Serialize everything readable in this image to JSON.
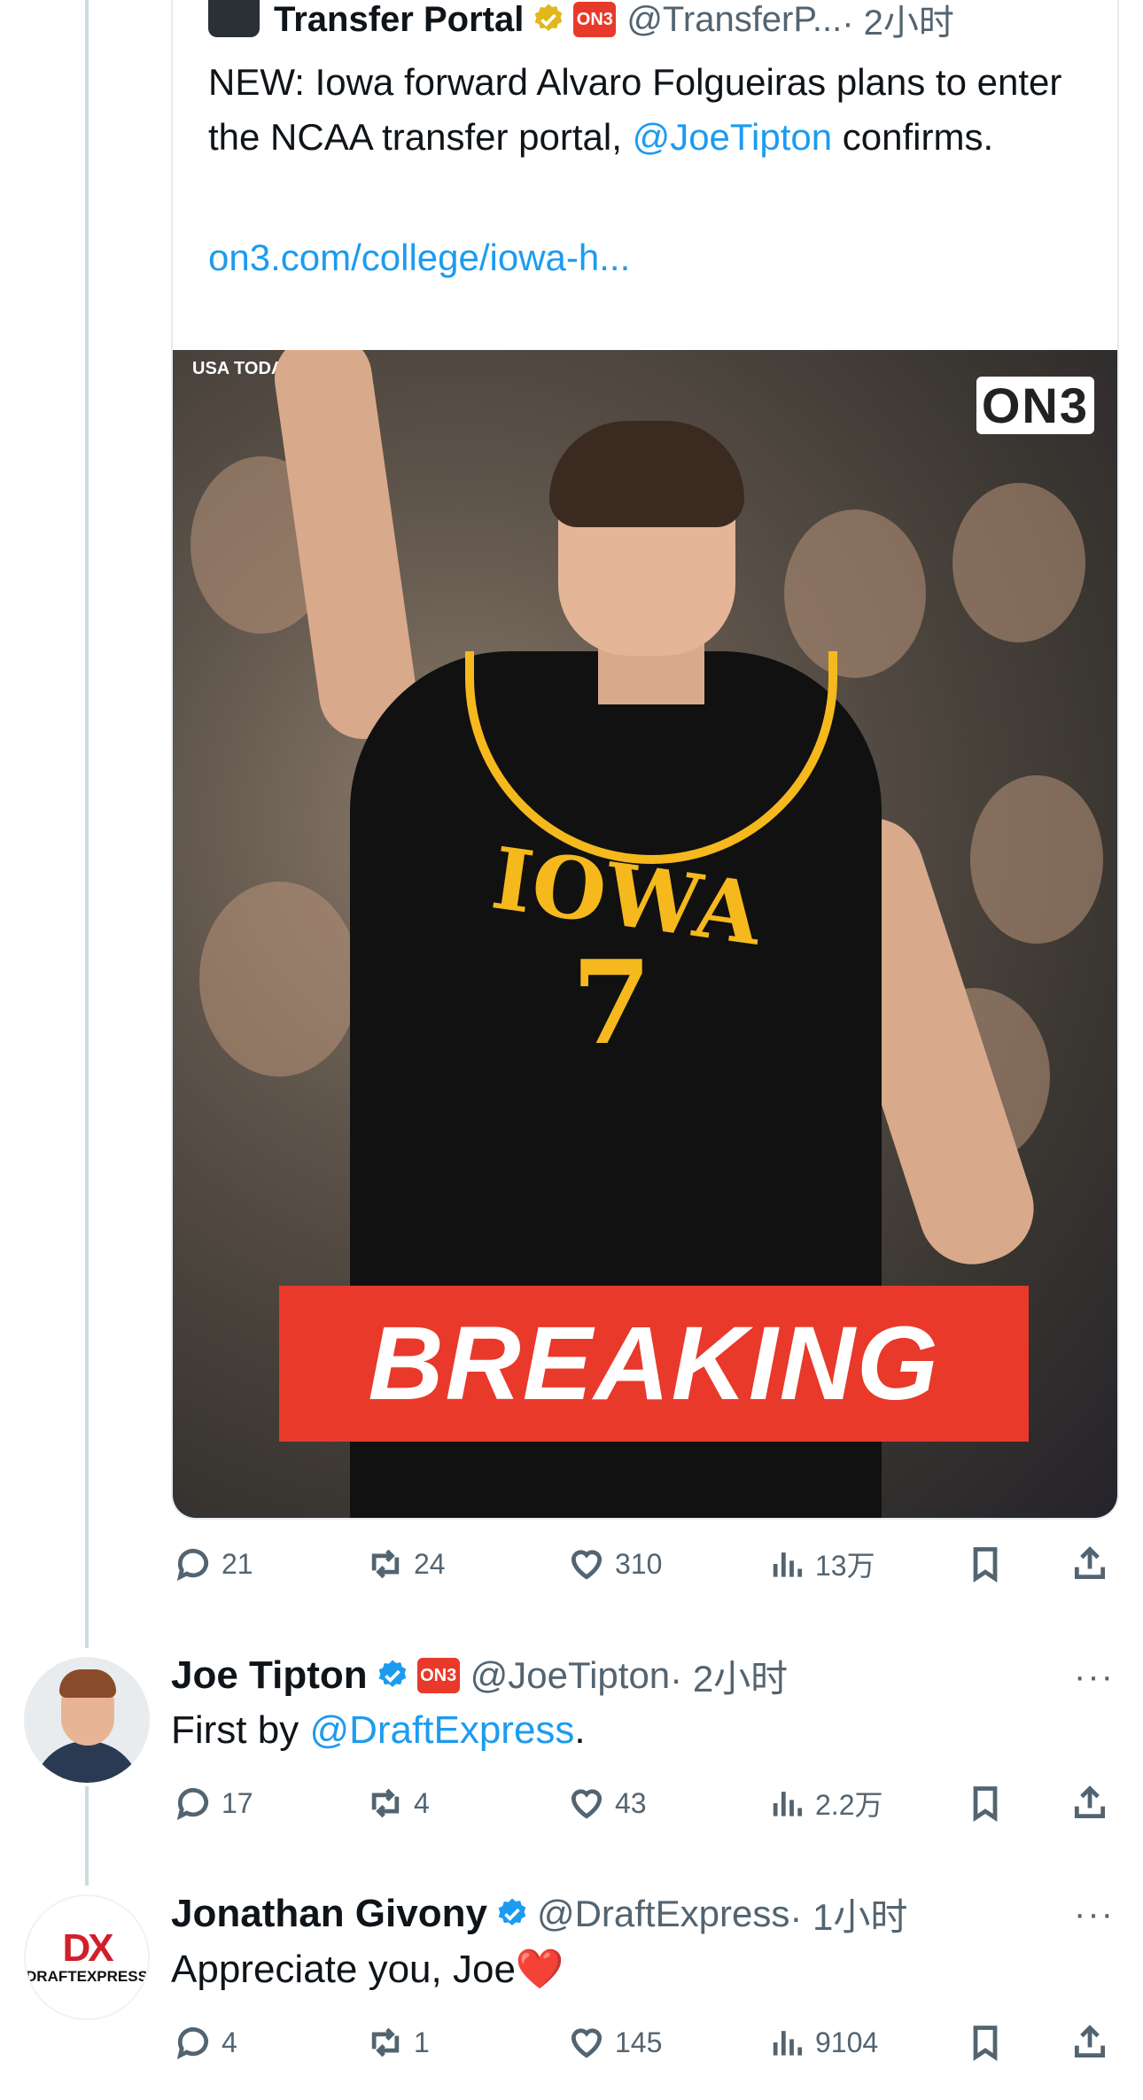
{
  "quoted_tweet": {
    "author_name": "Transfer Portal",
    "on3_badge": "ON3",
    "handle": "@TransferP...",
    "time": "· 2小时",
    "text_before": "NEW: Iowa forward Alvaro Folgueiras plans to enter the NCAA transfer portal, ",
    "mention": "@JoeTipton",
    "text_after": " confirms.",
    "link": "on3.com/college/iowa-h...",
    "media": {
      "credit": "USA TODAY",
      "logo": "ON3",
      "jersey_text": "IOWA",
      "jersey_number": "7",
      "banner": "BREAKING"
    },
    "actions": {
      "replies": "21",
      "retweets": "24",
      "likes": "310",
      "views": "13万"
    }
  },
  "replies": [
    {
      "name": "Joe Tipton",
      "badge": "ON3",
      "handle": "@JoeTipton",
      "time": "· 2小时",
      "text_before": "First by ",
      "mention": "@DraftExpress",
      "text_after": ".",
      "actions": {
        "replies": "17",
        "retweets": "4",
        "likes": "43",
        "views": "2.2万"
      }
    },
    {
      "name": "Jonathan Givony",
      "handle": "@DraftExpress",
      "time": "· 1小时",
      "text": "Appreciate you, Joe",
      "emoji": "❤️",
      "avatar_mark": "DX",
      "avatar_word": "DRAFTEXPRESS",
      "actions": {
        "replies": "4",
        "retweets": "1",
        "likes": "145",
        "views": "9104"
      }
    }
  ],
  "more_icon": "···",
  "colors": {
    "link": "#1d9bf0",
    "muted": "#536471",
    "breaking": "#e8392b",
    "iowa_gold": "#f5b91e"
  }
}
